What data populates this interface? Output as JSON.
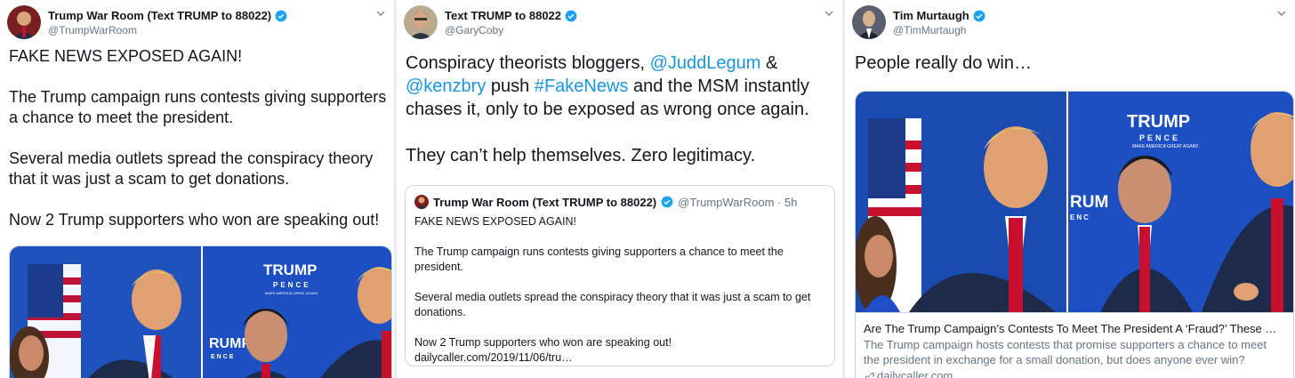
{
  "tweets": [
    {
      "name": "Trump War Room (Text TRUMP to 88022)",
      "handle": "@TrumpWarRoom",
      "body": "FAKE NEWS EXPOSED AGAIN!\n\nThe Trump campaign runs contests giving supporters a chance to meet the president.\n\nSeveral media outlets spread the conspiracy theory that it was just a scam to get donations.\n\nNow 2 Trump supporters who won are speaking out!",
      "media_sign_top": "TRUMP",
      "media_sign_mid": "PENCE",
      "media_sign_small": "MAKE AMERICA GREAT AGAIN!",
      "media_sign_left": "RUMP",
      "media_sign_left2": "ENCE"
    },
    {
      "name": "Text TRUMP to 88022",
      "handle": "@GaryCoby",
      "body_parts": {
        "t1": "Conspiracy theorists bloggers, ",
        "m1": "@JuddLegum",
        "t2": " & ",
        "m2": "@kenzbry",
        "t3": " push ",
        "h1": "#FakeNews",
        "t4": " and the MSM instantly chases it, only to be exposed as wrong once again.\n\nThey can’t help themselves. Zero legitimacy."
      },
      "quote": {
        "name": "Trump War Room (Text TRUMP to 88022)",
        "handle_time": "@TrumpWarRoom · 5h",
        "body": "FAKE NEWS EXPOSED AGAIN!\n\nThe Trump campaign runs contests giving supporters a chance to meet the president.\n\nSeveral media outlets spread the conspiracy theory that it was just a scam to get donations.\n\nNow 2 Trump supporters who won are speaking out!\ndailycaller.com/2019/11/06/tru…"
      }
    },
    {
      "name": "Tim Murtaugh",
      "handle": "@TimMurtaugh",
      "body": "People really do win…",
      "card": {
        "title": "Are The Trump Campaign’s Contests To Meet The President A ‘Fraud?’ These Win…",
        "desc": "The Trump campaign hosts contests that promise supporters a chance to meet the president in exchange for a small donation, but does anyone ever win?",
        "domain": "dailycaller.com",
        "sign_top": "TRUMP",
        "sign_mid": "PENCE",
        "sign_small": "MAKE AMERICA GREAT AGAIN!",
        "sign_left": "RUM",
        "sign_left2": "ENC"
      }
    }
  ],
  "colors": {
    "link": "#1b95e0",
    "verified": "#1da1f2",
    "text": "#14171a",
    "muted": "#657786",
    "border": "#ccd6dd",
    "backdrop": "#1a4bb0"
  },
  "icons": {
    "verified": "verified-badge-icon",
    "menu": "chevron-down-icon",
    "link": "link-icon"
  }
}
